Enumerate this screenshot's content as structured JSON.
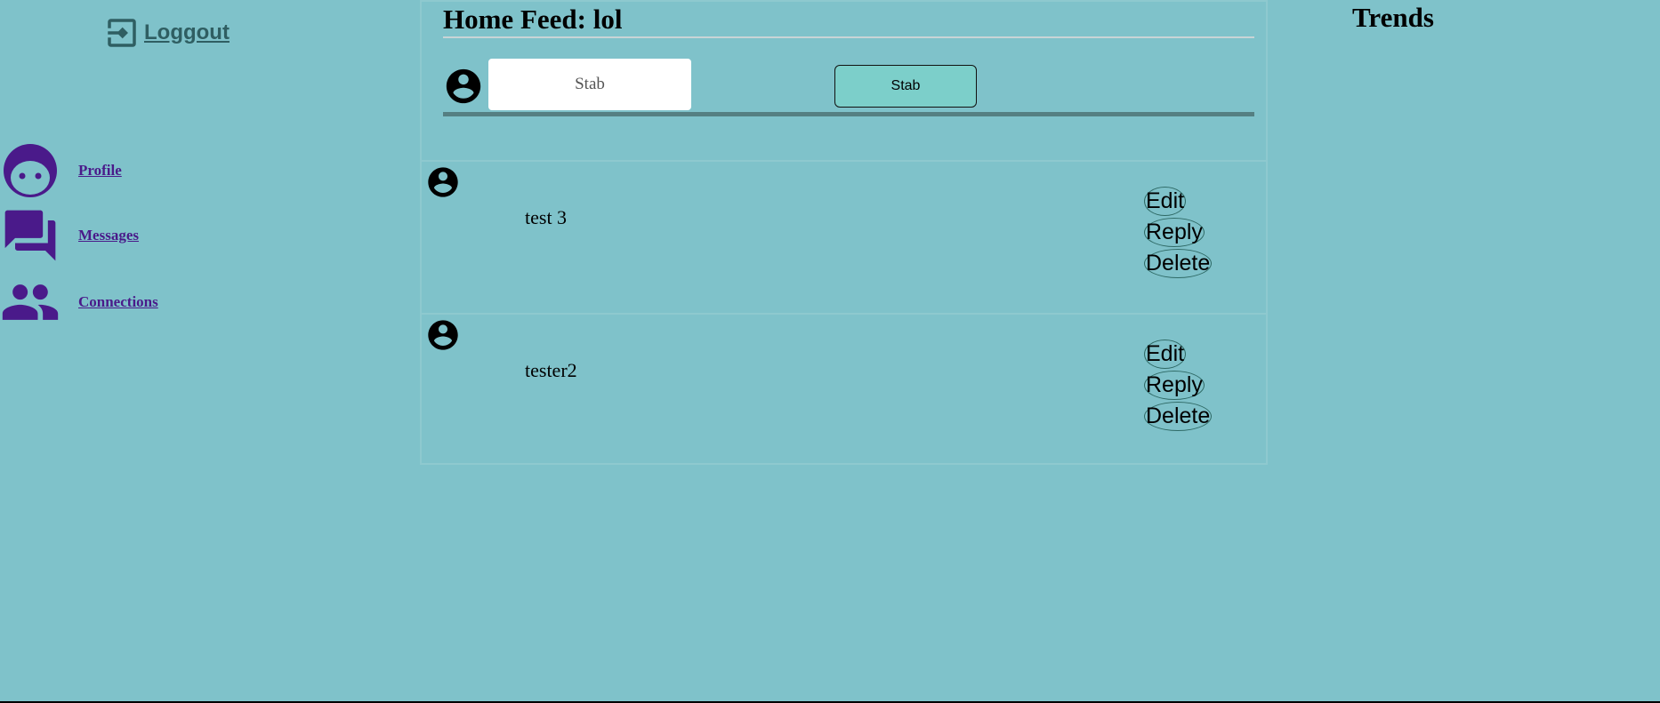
{
  "sidebar": {
    "logout_label": "Loggout",
    "items": [
      {
        "label": "Profile",
        "icon": "face-icon"
      },
      {
        "label": "Messages",
        "icon": "forum-icon"
      },
      {
        "label": "Connections",
        "icon": "people-icon"
      }
    ]
  },
  "feed": {
    "title": "Home Feed: lol",
    "composer": {
      "input_placeholder": "Stab",
      "button_label": "Stab"
    },
    "posts": [
      {
        "text": "test 3",
        "actions": [
          "Edit",
          "Reply",
          "Delete"
        ]
      },
      {
        "text": "tester2",
        "actions": [
          "Edit",
          "Reply",
          "Delete"
        ]
      }
    ]
  },
  "trends": {
    "title": "Trends"
  },
  "colors": {
    "background": "#7fc2ca",
    "nav_accent": "#4a1a8a",
    "logout": "#2f5e62",
    "button": "#7ccfca"
  }
}
